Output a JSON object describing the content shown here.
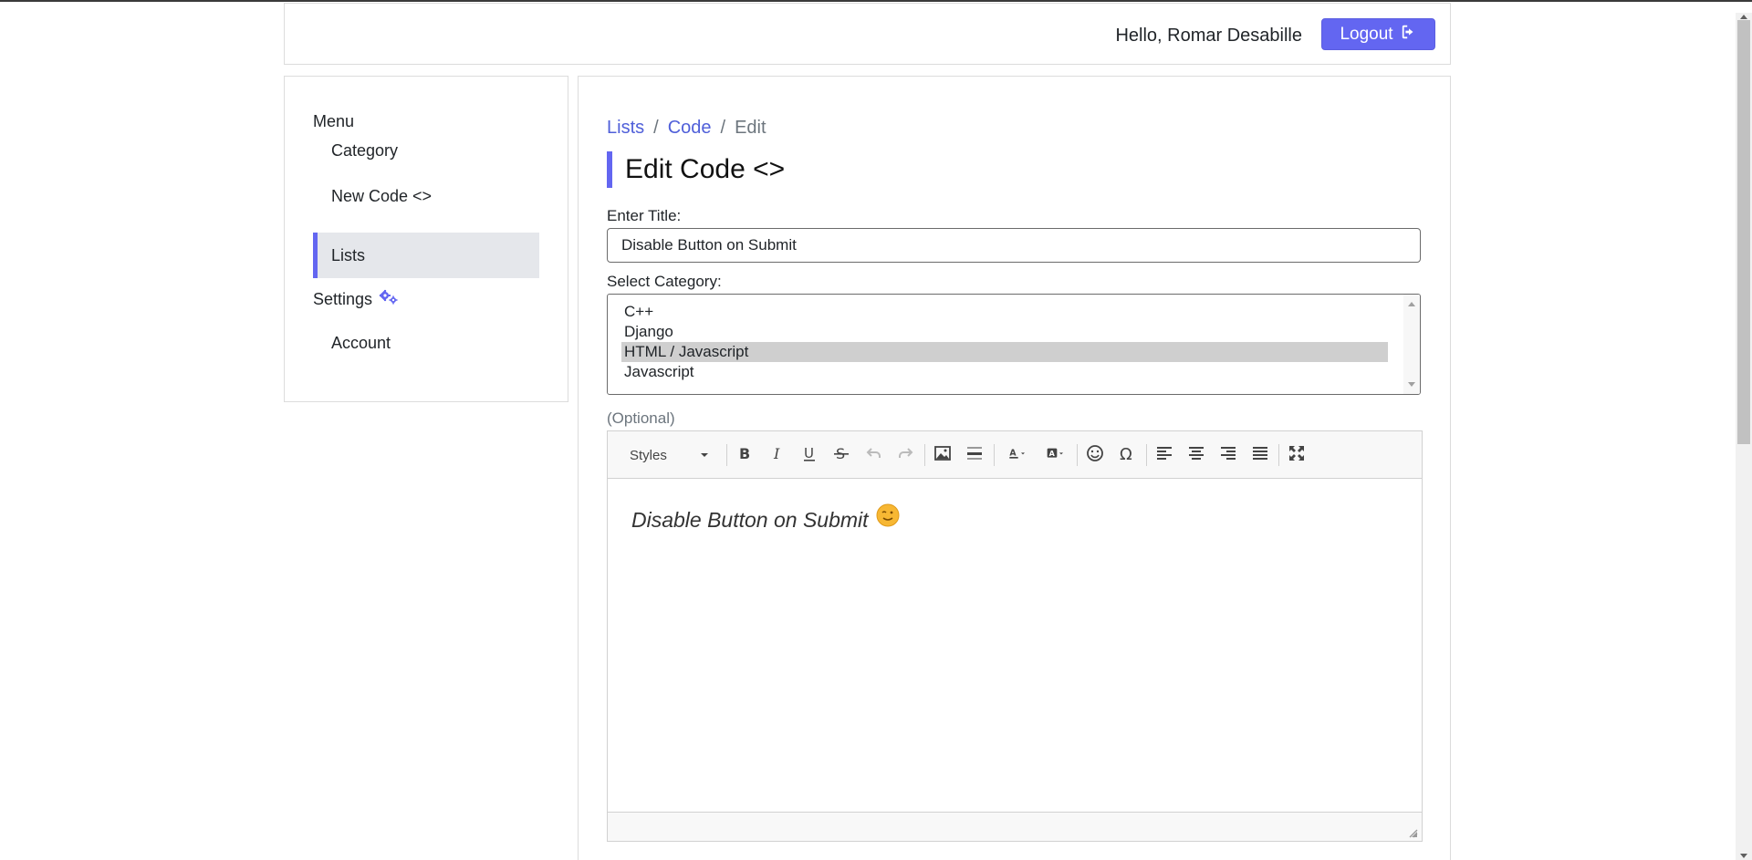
{
  "header": {
    "greeting": "Hello, Romar Desabille",
    "logout_label": "Logout"
  },
  "sidebar": {
    "menu_title": "Menu",
    "items": [
      {
        "label": "Category"
      },
      {
        "label": "New Code <>"
      },
      {
        "label": "Lists",
        "active": true
      }
    ],
    "settings_label": "Settings",
    "settings_icon": "gears-icon",
    "settings_items": [
      {
        "label": "Account"
      }
    ]
  },
  "main": {
    "breadcrumb": [
      "Lists",
      "Code",
      "Edit"
    ],
    "breadcrumb_separator": "/",
    "title": "Edit Code <>",
    "title_label": "Enter Title:",
    "title_value": "Disable Button on Submit",
    "category_label": "Select Category:",
    "categories": [
      "C++",
      "Django",
      "HTML / Javascript",
      "Javascript"
    ],
    "selected_category": "HTML / Javascript",
    "optional_label": "(Optional)",
    "editor": {
      "styles_label": "Styles",
      "content": "Disable Button on Submit",
      "content_emoji": "smiley-wink"
    }
  },
  "colors": {
    "accent": "#6366f1",
    "link": "#4f5fd9",
    "active_bg": "#e5e7eb"
  }
}
